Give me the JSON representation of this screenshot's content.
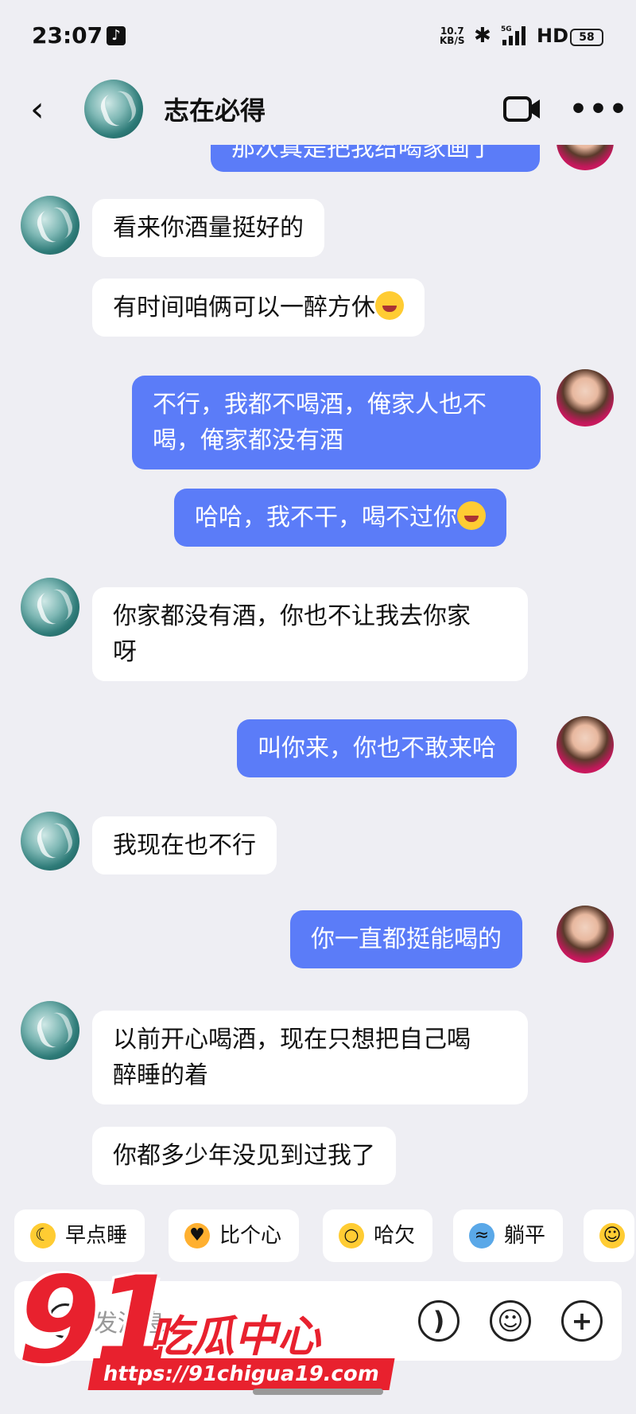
{
  "status_bar": {
    "time": "23:07",
    "net_speed_value": "10.7",
    "net_speed_unit": "KB/S",
    "network": "5G",
    "hd": "HD",
    "battery": "58"
  },
  "header": {
    "contact_name": "志在必得"
  },
  "messages": [
    {
      "from": "me",
      "text": "那次真是把我给喝家画了"
    },
    {
      "from": "friend",
      "text": "看来你酒量挺好的"
    },
    {
      "from": "friend",
      "text": "有时间咱俩可以一醉方休"
    },
    {
      "from": "me",
      "text_line1": "不行，我都不喝酒，俺家人也不",
      "text_line2": "喝，俺家都没有酒"
    },
    {
      "from": "me",
      "text": "哈哈，我不干，喝不过你"
    },
    {
      "from": "friend",
      "text_line1": "你家都没有酒，你也不让我去你家",
      "text_line2": "呀"
    },
    {
      "from": "me",
      "text": "叫你来，你也不敢来哈"
    },
    {
      "from": "friend",
      "text": "我现在也不行"
    },
    {
      "from": "me",
      "text": "你一直都挺能喝的"
    },
    {
      "from": "friend",
      "text_line1": "以前开心喝酒，现在只想把自己喝",
      "text_line2": "醉睡的着"
    },
    {
      "from": "friend",
      "text": "你都多少年没见到过我了"
    }
  ],
  "quick_chips": [
    {
      "label": "早点睡",
      "icon": "sleep-emoji-icon"
    },
    {
      "label": "比个心",
      "icon": "heart-chick-icon"
    },
    {
      "label": "哈欠",
      "icon": "yawn-emoji-icon"
    },
    {
      "label": "躺平",
      "icon": "lie-flat-icon"
    }
  ],
  "input": {
    "placeholder": "发消息"
  },
  "watermark": {
    "number": "91",
    "name": "吃瓜中心",
    "url": "https://91chigua19.com"
  }
}
